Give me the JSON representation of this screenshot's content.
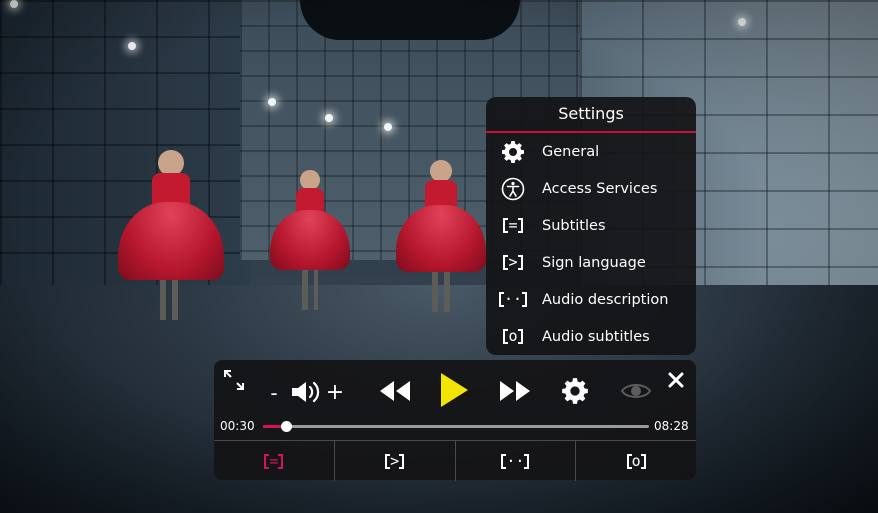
{
  "settings": {
    "title": "Settings",
    "items": [
      {
        "label": "General",
        "icon": "gear-icon"
      },
      {
        "label": "Access Services",
        "icon": "accessibility-icon"
      },
      {
        "label": "Subtitles",
        "icon": "subtitles-icon",
        "glyph": "="
      },
      {
        "label": "Sign language",
        "icon": "sign-language-icon",
        "glyph": ">"
      },
      {
        "label": "Audio description",
        "icon": "audio-description-icon",
        "glyph": "··"
      },
      {
        "label": "Audio subtitles",
        "icon": "audio-subtitles-icon",
        "glyph": "o"
      }
    ],
    "accent_color": "#c8103a"
  },
  "player": {
    "volume_down_label": "-",
    "volume_up_label": "+",
    "current_time": "00:30",
    "duration": "08:28",
    "progress": 0.0592,
    "play_color": "#f2e600",
    "tabs": [
      {
        "name": "subtitles",
        "glyph": "=",
        "active": true,
        "active_color": "#d4145a"
      },
      {
        "name": "sign-language",
        "glyph": ">",
        "active": false
      },
      {
        "name": "audio-description",
        "glyph": "··",
        "active": false
      },
      {
        "name": "audio-subtitles",
        "glyph": "o",
        "active": false
      }
    ]
  }
}
